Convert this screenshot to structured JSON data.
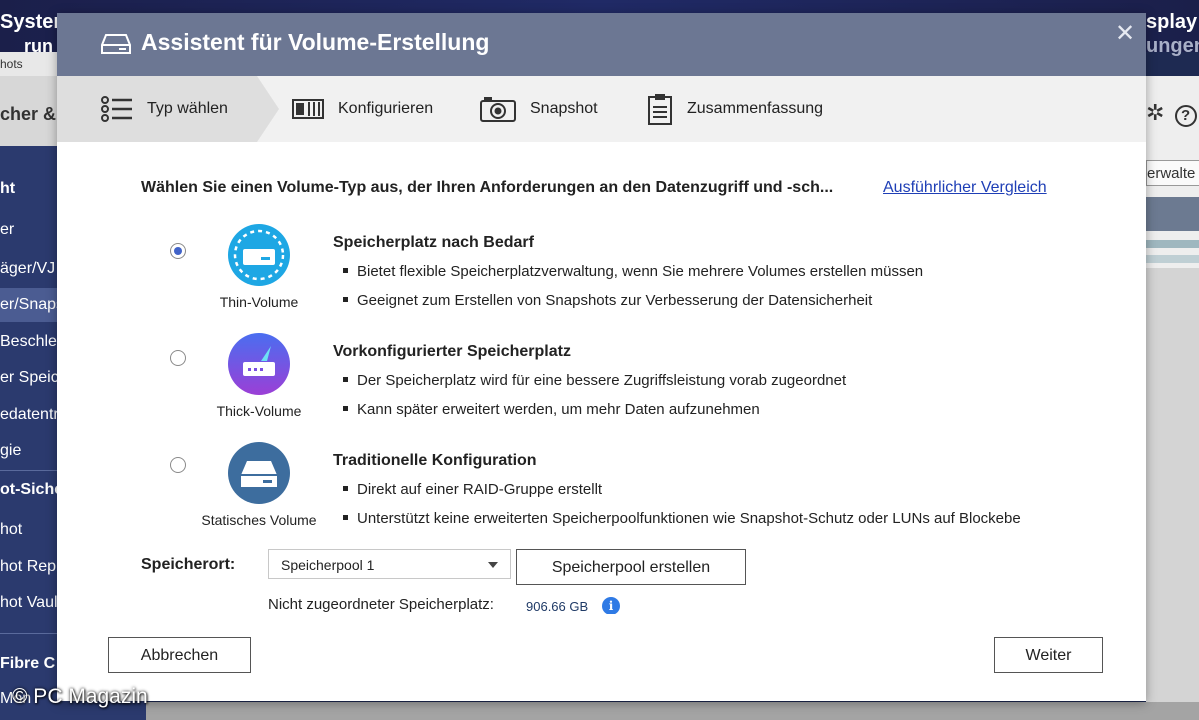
{
  "background": {
    "left_title_line1": "System",
    "left_title_line2": "run",
    "right_title_line1": "splay",
    "right_title_line2": "ungen",
    "breadcrumb": "hots",
    "section_title": "cher & S",
    "sidebar_items": [
      "ht",
      "er",
      "äger/VJ",
      "er/Snaps",
      "Beschle",
      "er Speich",
      "edatentr",
      "gie",
      "ot-Siche",
      "hot",
      "hot Repli",
      "hot Vault",
      "Fibre C",
      "Mon"
    ],
    "right_button": "erwalte"
  },
  "dialog": {
    "title": "Assistent für Volume-Erstellung",
    "close_glyph": "✕",
    "steps": [
      {
        "label": "Typ wählen",
        "active": true,
        "icon": "list-icon"
      },
      {
        "label": "Konfigurieren",
        "active": false,
        "icon": "configure-icon"
      },
      {
        "label": "Snapshot",
        "active": false,
        "icon": "camera-icon"
      },
      {
        "label": "Zusammenfassung",
        "active": false,
        "icon": "clipboard-icon"
      }
    ],
    "intro_text": "Wählen Sie einen Volume-Typ aus, der Ihren Anforderungen an den Datenzugriff und -sch...",
    "compare_link": "Ausführlicher Vergleich",
    "options": [
      {
        "label": "Thin-Volume",
        "title": "Speicherplatz nach Bedarf",
        "bullets": [
          "Bietet flexible Speicherplatzverwaltung, wenn Sie mehrere Volumes erstellen müssen",
          "Geeignet zum Erstellen von Snapshots zur Verbesserung der Datensicherheit"
        ],
        "selected": true,
        "icon_color": "#1ea7e4"
      },
      {
        "label": "Thick-Volume",
        "title": "Vorkonfigurierter Speicherplatz",
        "bullets": [
          "Der Speicherplatz wird für eine bessere Zugriffsleistung vorab zugeordnet",
          "Kann später erweitert werden, um mehr Daten aufzunehmen"
        ],
        "selected": false,
        "icon_color": "#7a4fe0"
      },
      {
        "label": "Statisches Volume",
        "title": "Traditionelle Konfiguration",
        "bullets": [
          "Direkt auf einer RAID-Gruppe erstellt",
          "Unterstützt keine erweiterten Speicherpoolfunktionen wie Snapshot-Schutz oder LUNs auf Blockebe"
        ],
        "selected": false,
        "icon_color": "#3d6d9e"
      }
    ],
    "location_label": "Speicherort:",
    "location_value": "Speicherpool 1",
    "create_pool_button": "Speicherpool erstellen",
    "unallocated_label": "Nicht zugeordneter Speicherplatz:",
    "unallocated_value": "906.66 GB",
    "info_glyph": "i",
    "cancel_button": "Abbrechen",
    "next_button": "Weiter"
  },
  "watermark": "© PC Magazin",
  "colors": {
    "header": "#6c7793",
    "accent": "#4163c8",
    "link": "#1f3fb6",
    "sidebar": "#2b3a6e"
  }
}
